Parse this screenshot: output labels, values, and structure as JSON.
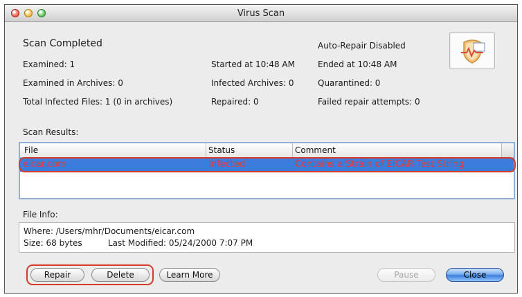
{
  "window": {
    "title": "Virus Scan"
  },
  "summary": {
    "heading": "Scan Completed",
    "examined": "Examined: 1",
    "examined_archives": "Examined in Archives: 0",
    "total_infected": "Total Infected Files: 1 (0 in archives)",
    "started": "Started at 10:48 AM",
    "infected_archives": "Infected Archives: 0",
    "repaired": "Repaired: 0",
    "auto_repair": "Auto-Repair Disabled",
    "ended": "Ended at 10:48 AM",
    "quarantined": "Quarantined: 0",
    "failed_repairs": "Failed repair attempts: 0"
  },
  "results": {
    "label": "Scan Results:",
    "columns": [
      "File",
      "Status",
      "Comment"
    ],
    "rows": [
      {
        "file": "eicar.com",
        "status": "Infected",
        "comment": "Contains a Strain of EICAR Test String"
      }
    ]
  },
  "file_info": {
    "label": "File Info:",
    "where": "Where: /Users/mhr/Documents/eicar.com",
    "size": "Size: 68 bytes",
    "modified": "Last Modified: 05/24/2000 7:07 PM"
  },
  "buttons": {
    "repair": "Repair",
    "delete": "Delete",
    "learn_more": "Learn More",
    "pause": "Pause",
    "close": "Close"
  },
  "colors": {
    "selection": "#3b7ddc",
    "infected_text": "#e23a3a",
    "highlight_outline": "#d63b2a",
    "primary_button": "#3d7fdb"
  },
  "icons": {
    "app_logo": "shield-heartbeat-icon"
  }
}
